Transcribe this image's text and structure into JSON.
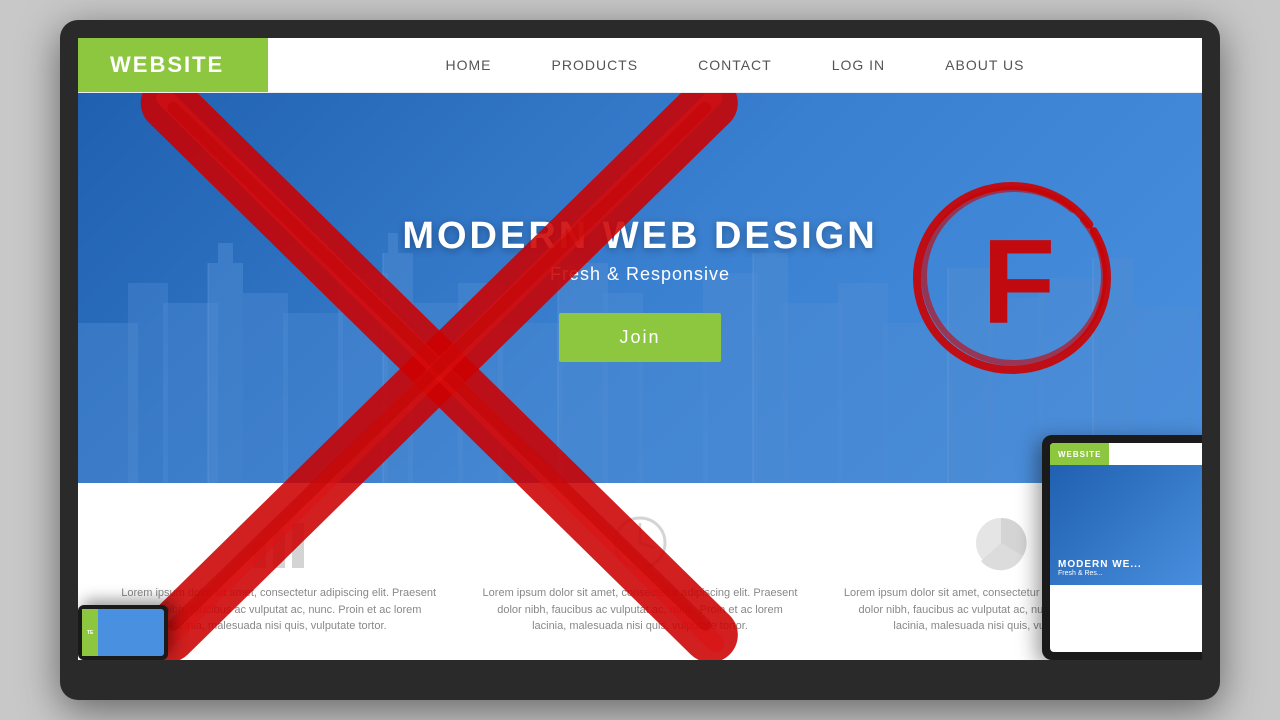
{
  "monitor": {
    "label": "Monitor"
  },
  "navbar": {
    "brand": "WEBSITE",
    "links": [
      {
        "label": "HOME",
        "id": "home"
      },
      {
        "label": "PRODUCTS",
        "id": "products"
      },
      {
        "label": "CONTACT",
        "id": "contact"
      },
      {
        "label": "LOG IN",
        "id": "login"
      },
      {
        "label": "ABOUT US",
        "id": "about"
      }
    ]
  },
  "hero": {
    "title": "MODERN WEB DESIGN",
    "subtitle": "Fresh & Responsive",
    "button_label": "Join"
  },
  "features": [
    {
      "icon": "bar-chart-icon",
      "text": "Lorem ipsum dolor sit amet, consectetur adipiscing elit. Praesent dolor nibh, faucibus ac vulputat ac, nunc. Proin et ac lorem lacinia, malesuada nisi quis, vulputate tortor."
    },
    {
      "icon": "clock-icon",
      "text": "Lorem ipsum dolor sit amet, consectetur adipiscing elit. Praesent dolor nibh, faucibus ac vulputat ac, nunc. Proin et ac lorem lacinia, malesuada nisi quis, vulputate tortor."
    },
    {
      "icon": "pie-chart-icon",
      "text": "Lorem ipsum dolor sit amet, consectetur adipiscing elit. Praesent dolor nibh, faucibus ac vulputat ac, nunc. Proin et ac lorem lacinia, malesuada nisi quis, vulputate tortor."
    }
  ],
  "tablet": {
    "brand": "WEBSITE",
    "hero_title": "MODERN WE...",
    "hero_subtitle": "Fresh & Res..."
  },
  "phone": {
    "brand": "TE"
  },
  "grade": {
    "letter": "F"
  },
  "colors": {
    "green": "#8dc63f",
    "blue": "#3070c0",
    "red": "#cc0000",
    "dark": "#2a2a2a"
  }
}
